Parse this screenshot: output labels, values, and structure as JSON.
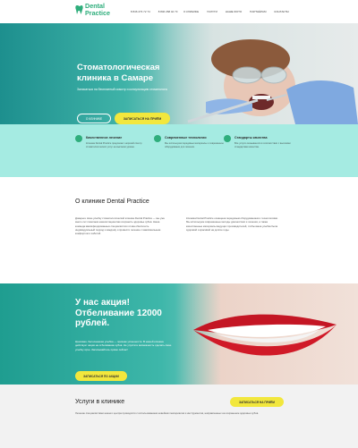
{
  "header": {
    "logo_line1": "Dental",
    "logo_line2": "Practice",
    "phones": [
      "8 846 273 72 74",
      "8 846 268 42 73"
    ],
    "nav": [
      "О клинике",
      "Услуги",
      "Наше фото",
      "Партнёрам",
      "Контакты"
    ]
  },
  "hero": {
    "title": "Стоматологическая клиника в Самаре",
    "subtitle": "Записаться на бесплатный осмотр и консультацию стоматолога",
    "btn_about": "О КЛИНИКЕ",
    "btn_signup": "ЗАПИСАТЬСЯ НА ПРИЁМ"
  },
  "features": [
    {
      "title": "Качественное лечение",
      "text": "Клиника Dental Practice предлагает широкий спектр стоматологических услуг на высоком уровне."
    },
    {
      "title": "Современные технологии",
      "text": "Мы используем передовые материалы и современное оборудование для лечения."
    },
    {
      "title": "Стандарты качества",
      "text": "Все услуги оказываются в соответствии с высокими стандартами качества."
    }
  ],
  "about": {
    "title": "О клинике Dental Practice",
    "col1": "Доверьте свою улыбку стоматологической клинике Dental Practice — мы уже много лет помогаем нашим пациентам сохранить здоровье зубов. Наша команда квалифицированных специалистов готова обеспечить индивидуальный подход к каждому и провести лечение с максимальным комфортом и заботой.",
    "col2": "Клиника Dental Practice оснащена передовым оборудованием и технологиями. Мы используем современные методы диагностики и лечения, а также качественные материалы ведущих производителей, чтобы ваша улыбка была здоровой и красивой на долгие годы."
  },
  "promo": {
    "title": "У нас акция! Отбеливание 12000 рублей.",
    "text": "Красивая, белоснежная улыбка — признак успешности. В нашей клинике действует акция на отбеливание зубов. Не упустите возможность сделать свою улыбку ярче. Записывайтесь прямо сейчас!",
    "button": "ЗАПИСАТЬСЯ ПО АКЦИИ"
  },
  "services": {
    "title": "Услуги в клинике",
    "button": "ЗАПИСАТЬСЯ НА ПРИЁМ",
    "text": "Лечение специалистами нашего центра проводится с использованием новейших материалов и инструментов, направленных на сохранение здоровья зубов."
  },
  "colors": {
    "accent_green": "#2fae7c",
    "teal": "#3eb7aa",
    "mint": "#a5ebe2",
    "yellow": "#f2e73d"
  }
}
